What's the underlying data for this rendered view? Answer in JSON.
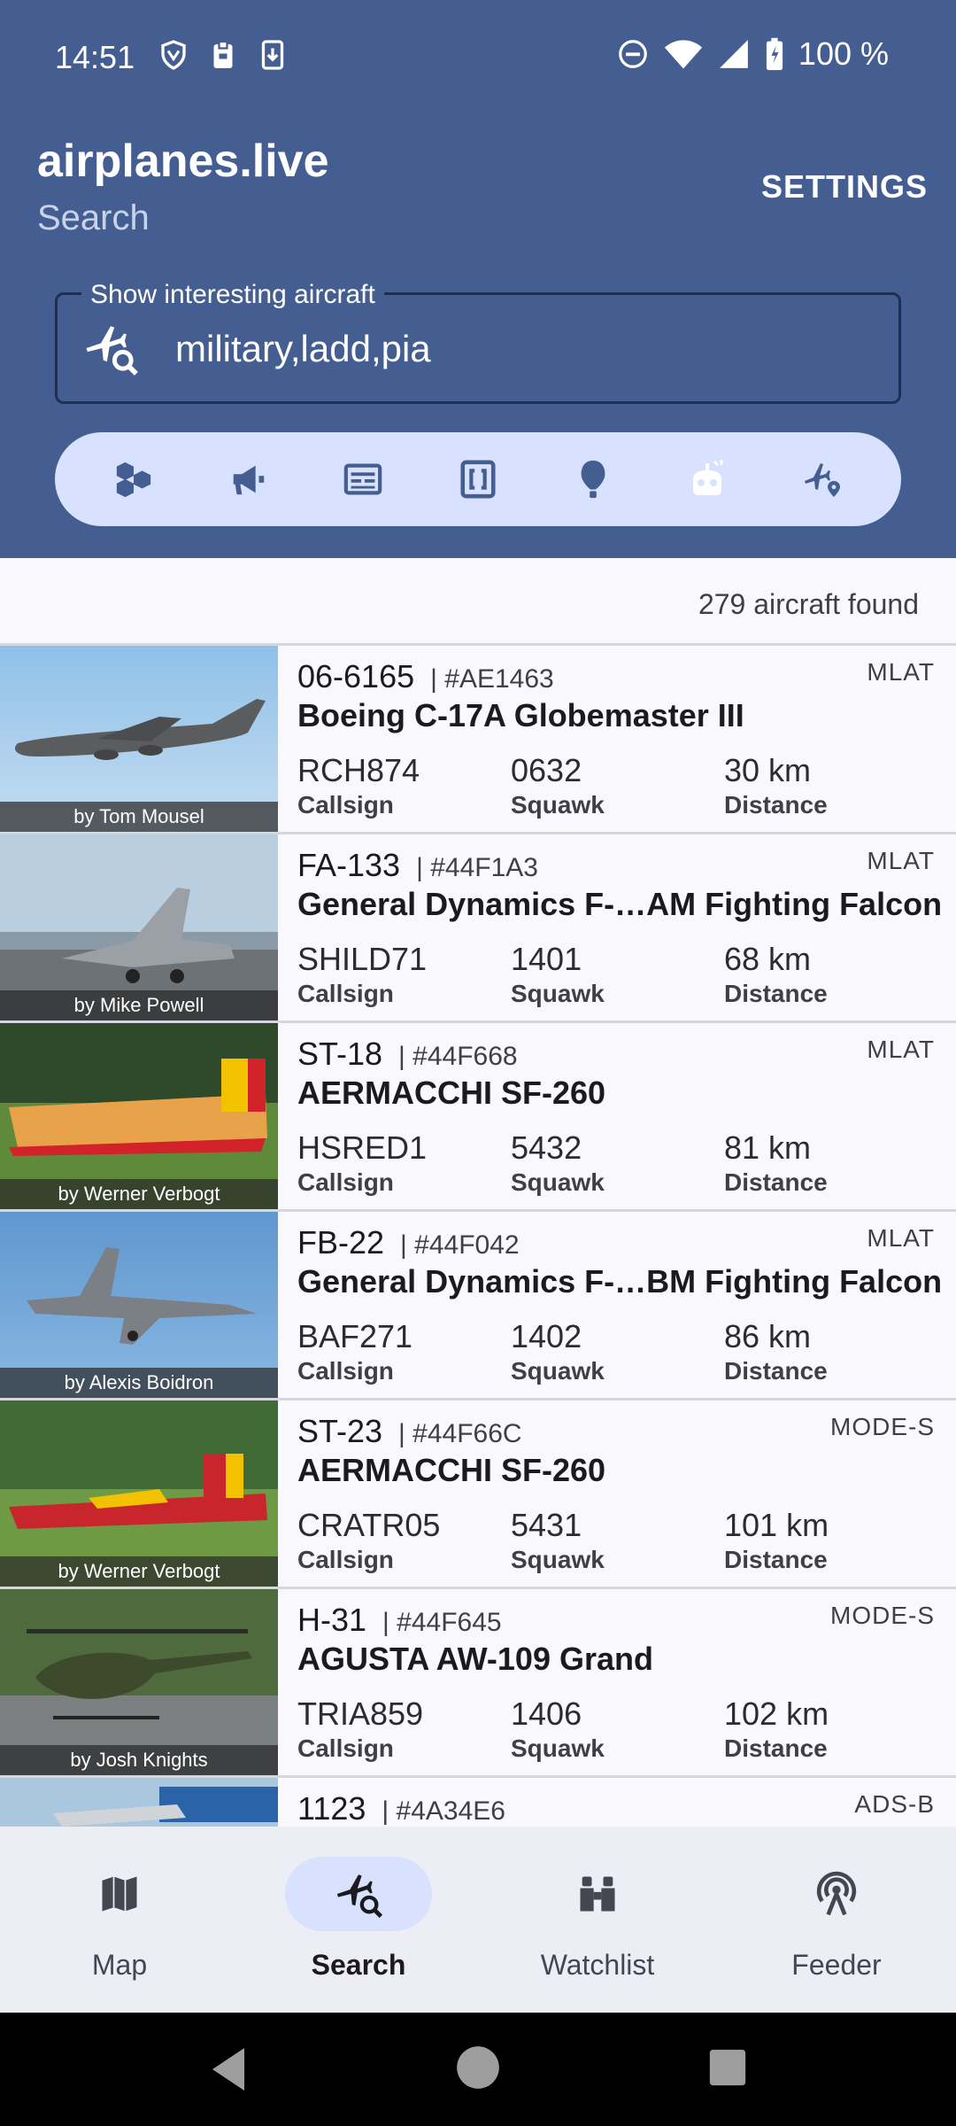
{
  "status_bar": {
    "time": "14:51",
    "battery": "100 %",
    "icons_left": [
      "vpn-shield-icon",
      "clipboard-icon",
      "download-icon"
    ],
    "icons_right": [
      "dnd-icon",
      "wifi-icon",
      "signal-icon",
      "battery-icon"
    ]
  },
  "header": {
    "app_name": "airplanes.live",
    "subtitle": "Search",
    "settings_label": "SETTINGS"
  },
  "search": {
    "label": "Show interesting aircraft",
    "value": "military,ladd,pia"
  },
  "filters": [
    "hexagons-icon",
    "megaphone-icon",
    "card-icon",
    "brackets-icon",
    "balloon-icon",
    "drone-icon",
    "plane-location-icon"
  ],
  "results": {
    "count_text": "279 aircraft found",
    "field_labels": {
      "callsign": "Callsign",
      "squawk": "Squawk",
      "distance": "Distance"
    },
    "items": [
      {
        "reg": "06-6165",
        "hex": "| #AE1463",
        "source": "MLAT",
        "type": "Boeing C-17A Globemaster III",
        "callsign": "RCH874",
        "squawk": "0632",
        "distance": "30 km",
        "credit": "by Tom Mousel"
      },
      {
        "reg": "FA-133",
        "hex": "| #44F1A3",
        "source": "MLAT",
        "type": "General Dynamics F-…AM Fighting Falcon",
        "callsign": "SHILD71",
        "squawk": "1401",
        "distance": "68 km",
        "credit": "by Mike Powell"
      },
      {
        "reg": "ST-18",
        "hex": "| #44F668",
        "source": "MLAT",
        "type": "AERMACCHI SF-260",
        "callsign": "HSRED1",
        "squawk": "5432",
        "distance": "81 km",
        "credit": "by Werner Verbogt"
      },
      {
        "reg": "FB-22",
        "hex": "| #44F042",
        "source": "MLAT",
        "type": "General Dynamics F-…BM Fighting Falcon",
        "callsign": "BAF271",
        "squawk": "1402",
        "distance": "86 km",
        "credit": "by Alexis Boidron"
      },
      {
        "reg": "ST-23",
        "hex": "| #44F66C",
        "source": "MODE-S",
        "type": "AERMACCHI SF-260",
        "callsign": "CRATR05",
        "squawk": "5431",
        "distance": "101 km",
        "credit": "by Werner Verbogt"
      },
      {
        "reg": "H-31",
        "hex": "| #44F645",
        "source": "MODE-S",
        "type": "AGUSTA AW-109 Grand",
        "callsign": "TRIA859",
        "squawk": "1406",
        "distance": "102 km",
        "credit": "by Josh Knights"
      },
      {
        "reg": "1123",
        "hex": "| #4A34E6",
        "source": "ADS-B",
        "type": "",
        "callsign": "",
        "squawk": "",
        "distance": "",
        "credit": ""
      }
    ]
  },
  "bottom_nav": [
    {
      "label": "Map",
      "icon": "map-icon"
    },
    {
      "label": "Search",
      "icon": "plane-search-icon",
      "active": true
    },
    {
      "label": "Watchlist",
      "icon": "binoculars-icon"
    },
    {
      "label": "Feeder",
      "icon": "antenna-icon"
    }
  ],
  "colors": {
    "header_bg": "#455e91",
    "pill_bg": "#d8e2ff",
    "nav_bg": "#edeef5"
  }
}
